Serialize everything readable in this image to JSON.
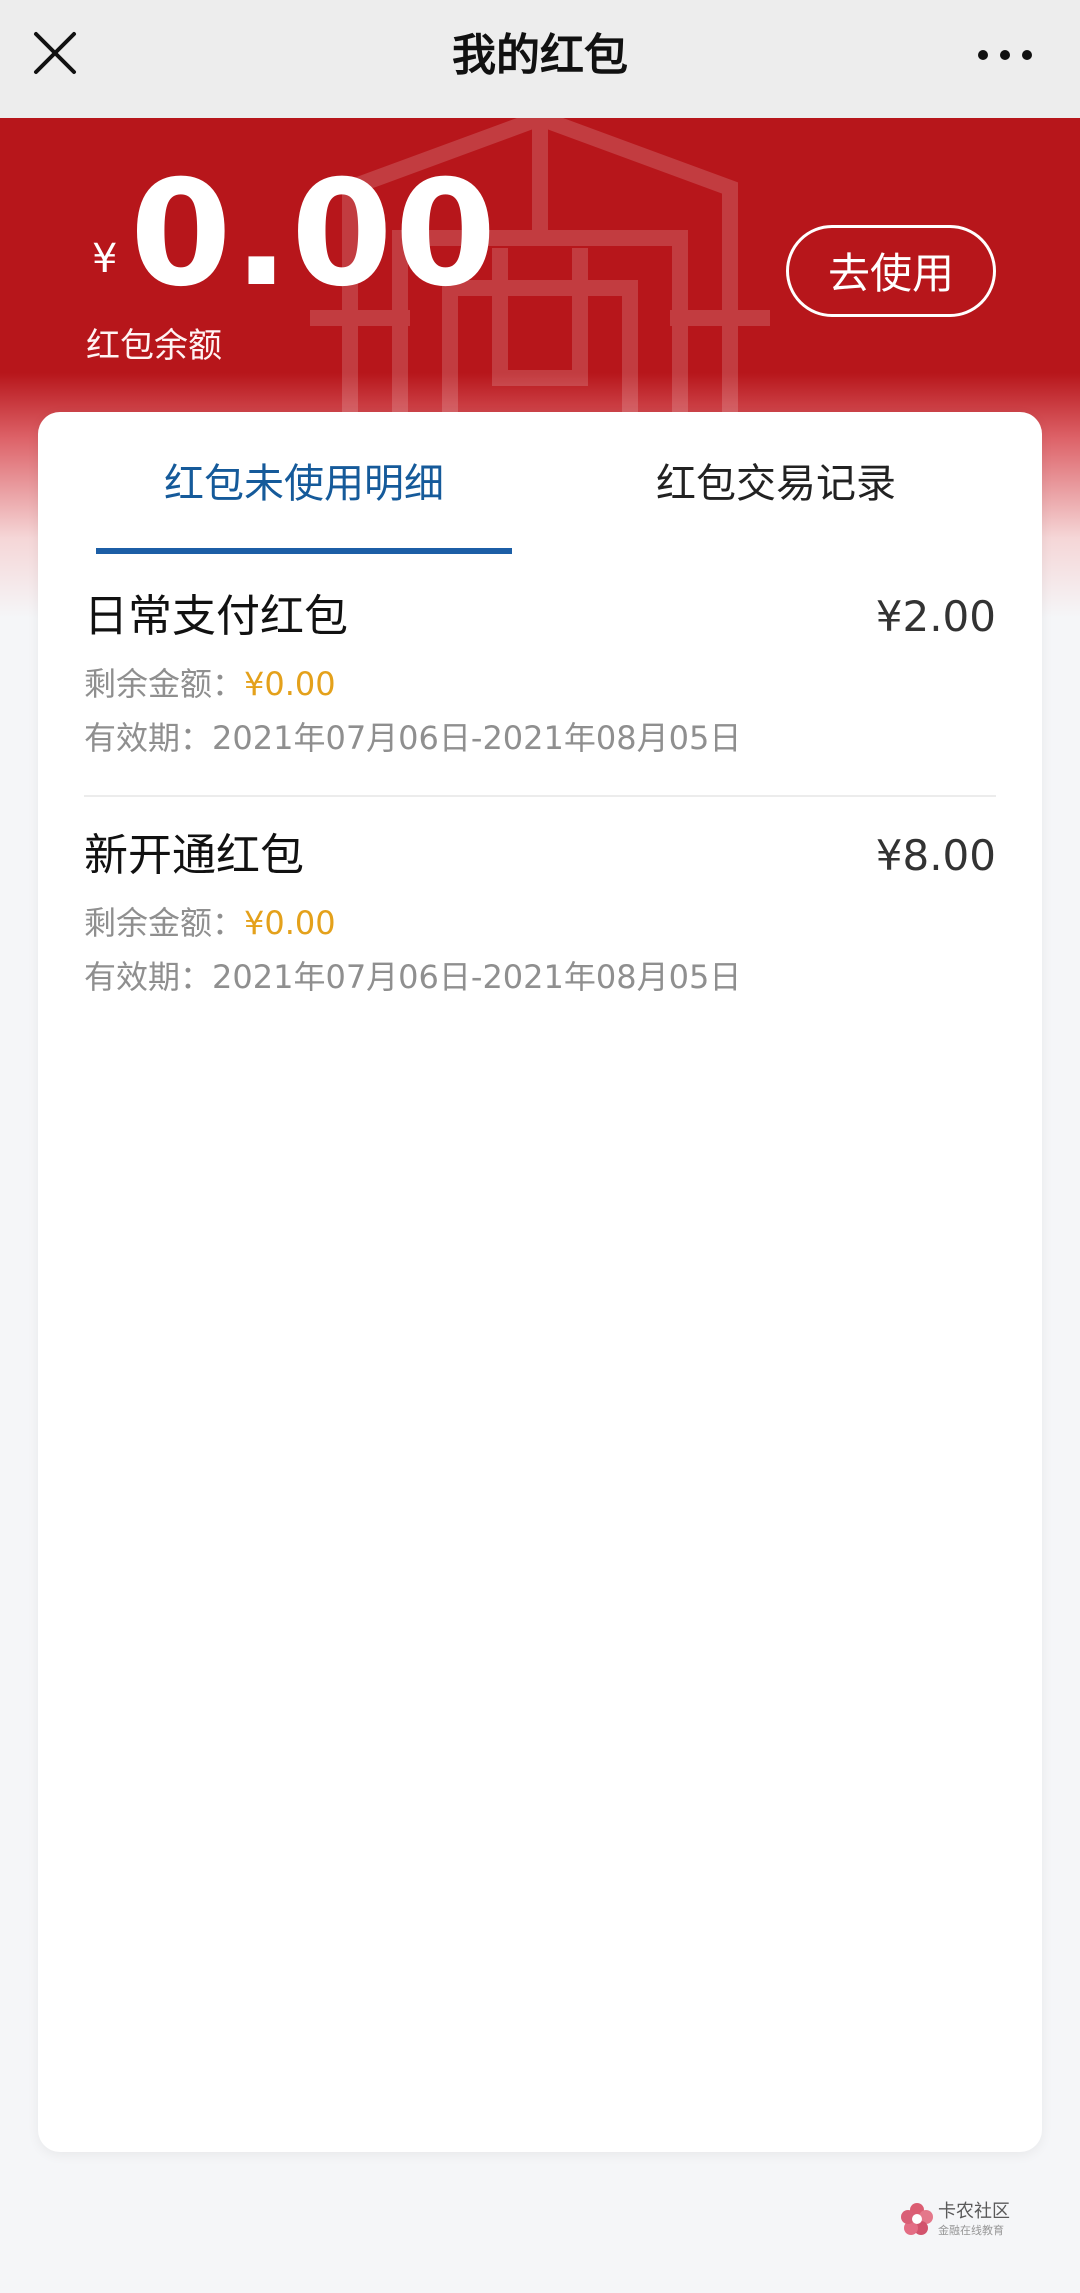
{
  "header": {
    "title": "我的红包",
    "close_icon": "close-icon",
    "more_icon": "more-icon"
  },
  "hero": {
    "currency_symbol": "¥",
    "balance": "0.00",
    "balance_label": "红包余额",
    "use_button": "去使用"
  },
  "tabs": [
    {
      "label": "红包未使用明细",
      "selected": true
    },
    {
      "label": "红包交易记录",
      "selected": false
    }
  ],
  "items": [
    {
      "name": "日常支付红包",
      "price": "¥2.00",
      "remaining_label": "剩余金额：",
      "remaining_value": "¥0.00",
      "valid_label": "有效期：",
      "valid_value": "2021年07月06日-2021年08月05日"
    },
    {
      "name": "新开通红包",
      "price": "¥8.00",
      "remaining_label": "剩余金额：",
      "remaining_value": "¥0.00",
      "valid_label": "有效期：",
      "valid_value": "2021年07月06日-2021年08月05日"
    }
  ],
  "watermark": {
    "title": "卡农社区",
    "subtitle": "金融在线教育"
  },
  "colors": {
    "header_bg": "#ededed",
    "hero_red": "#b7161b",
    "tab_active": "#155a9a",
    "indicator": "#1c5ea6",
    "remaining": "#e4a11b",
    "muted_text": "#8f8f8f",
    "page_bg": "#f5f6f8"
  }
}
